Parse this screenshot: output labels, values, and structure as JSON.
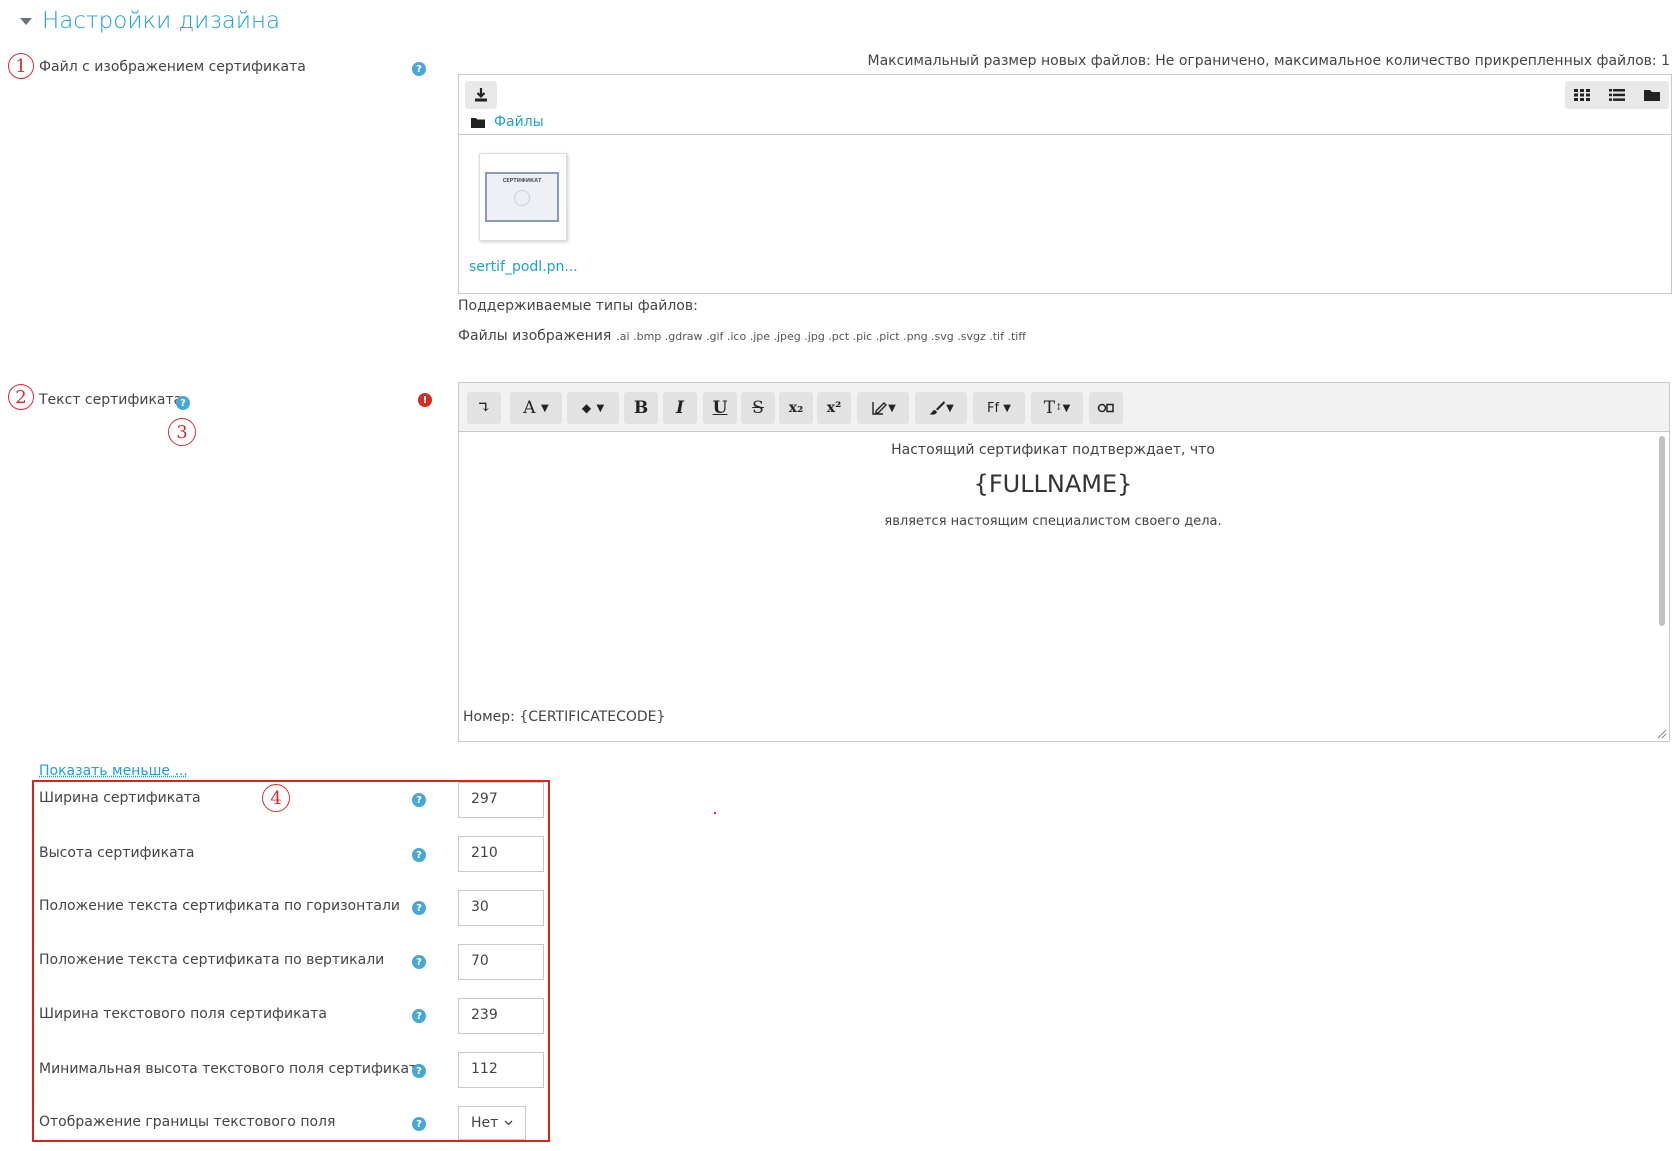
{
  "section": {
    "title": "Настройки дизайна"
  },
  "callouts": [
    "1",
    "2",
    "3",
    "4"
  ],
  "file_field": {
    "label": "Файл с изображением сертификата",
    "limits_text": "Максимальный размер новых файлов: Не ограничено, максимальное количество прикрепленных файлов: 1",
    "folder_label": "Файлы",
    "file": {
      "name": "sertif_podl.pn...",
      "thumb_caption": "СЕРТИФИКАТ"
    },
    "supported_title": "Поддерживаемые типы файлов:",
    "supported_group": "Файлы изображения",
    "supported_exts": ".ai .bmp .gdraw .gif .ico .jpe .jpeg .jpg .pct .pic .pict .png .svg .svgz .tif .tiff"
  },
  "text_field": {
    "label": "Текст сертификата",
    "toolbar": [
      "↴",
      "A",
      "◆",
      "B",
      "I",
      "U",
      "S",
      "x₂",
      "x²",
      "Ff",
      "T"
    ],
    "content": {
      "line1": "Настоящий сертификат подтверждает, что",
      "line2": "{FULLNAME}",
      "line3": "является настоящим специалистом своего дела.",
      "footer": "Номер: {CERTIFICATECODE}"
    }
  },
  "show_less_link": "Показать меньше ...",
  "settings": [
    {
      "label": "Ширина сертификата",
      "value": "297"
    },
    {
      "label": "Высота сертификата",
      "value": "210"
    },
    {
      "label": "Положение текста сертификата по горизонтали",
      "value": "30"
    },
    {
      "label": "Положение текста сертификата по вертикали",
      "value": "70"
    },
    {
      "label": "Ширина текстового поля сертификата",
      "value": "239"
    },
    {
      "label": "Минимальная высота текстового поля сертификата",
      "value": "112"
    },
    {
      "label": "Отображение границы текстового поля",
      "value": "Нет"
    }
  ],
  "colors": {
    "accent": "#1ba0d8",
    "help": "#48a7d4",
    "required": "#ca3120",
    "annotation": "#e02020"
  }
}
